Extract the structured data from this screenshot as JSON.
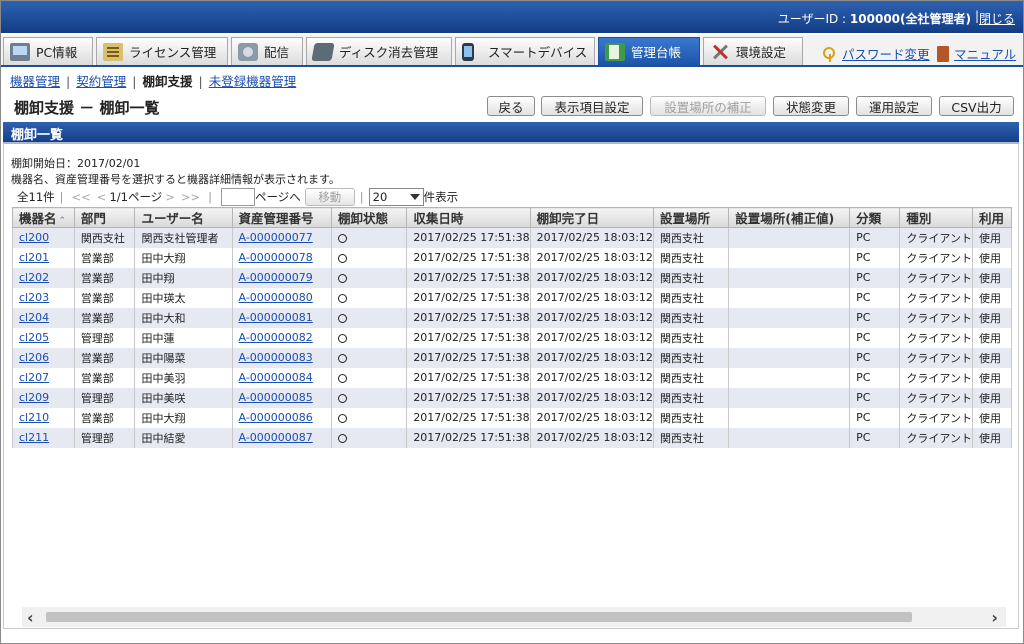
{
  "header": {
    "user_label": "ユーザーID : ",
    "user_value": "100000(全社管理者)",
    "close_label": "閉じる"
  },
  "tabs": [
    {
      "label": "PC情報",
      "icon": "pc-icon"
    },
    {
      "label": "ライセンス管理",
      "icon": "license-icon"
    },
    {
      "label": "配信",
      "icon": "distribution-icon"
    },
    {
      "label": "ディスク消去管理",
      "icon": "disk-erase-icon"
    },
    {
      "label": "スマートデバイス",
      "icon": "smartphone-icon"
    },
    {
      "label": "管理台帳",
      "icon": "ledger-icon"
    },
    {
      "label": "環境設定",
      "icon": "tools-icon"
    }
  ],
  "util_links": {
    "password": "パスワード変更",
    "manual": "マニュアル"
  },
  "subnav": {
    "item1": "機器管理",
    "item2": "契約管理",
    "item3": "棚卸支援",
    "item4": "未登録機器管理"
  },
  "page": {
    "title": "棚卸支援 － 棚卸一覧",
    "section_title": "棚卸一覧",
    "start_date": "棚卸開始日：2017/02/01",
    "hint": "機器名、資産管理番号を選択すると機器詳細情報が表示されます。"
  },
  "buttons": {
    "back": "戻る",
    "display_items": "表示項目設定",
    "correct_location": "設置場所の補正",
    "change_status": "状態変更",
    "operation_settings": "運用設定",
    "csv": "CSV出力"
  },
  "pager": {
    "total": "全11件",
    "first": "<<",
    "prev": "<",
    "page_info": "1/1ページ",
    "next": ">",
    "last": ">>",
    "page_input_value": "",
    "page_suffix": "ページへ",
    "move": "移動",
    "per_page": "20",
    "per_page_suffix": "件表示"
  },
  "table": {
    "columns": [
      "機器名",
      "部門",
      "ユーザー名",
      "資産管理番号",
      "棚卸状態",
      "収集日時",
      "棚卸完了日",
      "設置場所",
      "設置場所(補正値)",
      "分類",
      "種別",
      "利用"
    ],
    "sorted_column_icon": "sort-asc-icon",
    "rows": [
      {
        "device": "cl200",
        "dept": "関西支社",
        "user": "関西支社管理者",
        "asset": "A-000000077",
        "status": "○",
        "collected": "2017/02/25 17:51:38",
        "completed": "2017/02/25 18:03:12",
        "location": "関西支社",
        "location_corrected": "",
        "category": "PC",
        "type": "クライアント",
        "usage": "使用"
      },
      {
        "device": "cl201",
        "dept": "営業部",
        "user": "田中大翔",
        "asset": "A-000000078",
        "status": "○",
        "collected": "2017/02/25 17:51:38",
        "completed": "2017/02/25 18:03:12",
        "location": "関西支社",
        "location_corrected": "",
        "category": "PC",
        "type": "クライアント",
        "usage": "使用"
      },
      {
        "device": "cl202",
        "dept": "営業部",
        "user": "田中翔",
        "asset": "A-000000079",
        "status": "○",
        "collected": "2017/02/25 17:51:38",
        "completed": "2017/02/25 18:03:12",
        "location": "関西支社",
        "location_corrected": "",
        "category": "PC",
        "type": "クライアント",
        "usage": "使用"
      },
      {
        "device": "cl203",
        "dept": "営業部",
        "user": "田中瑛太",
        "asset": "A-000000080",
        "status": "○",
        "collected": "2017/02/25 17:51:38",
        "completed": "2017/02/25 18:03:12",
        "location": "関西支社",
        "location_corrected": "",
        "category": "PC",
        "type": "クライアント",
        "usage": "使用"
      },
      {
        "device": "cl204",
        "dept": "営業部",
        "user": "田中大和",
        "asset": "A-000000081",
        "status": "○",
        "collected": "2017/02/25 17:51:38",
        "completed": "2017/02/25 18:03:12",
        "location": "関西支社",
        "location_corrected": "",
        "category": "PC",
        "type": "クライアント",
        "usage": "使用"
      },
      {
        "device": "cl205",
        "dept": "管理部",
        "user": "田中蓮",
        "asset": "A-000000082",
        "status": "○",
        "collected": "2017/02/25 17:51:38",
        "completed": "2017/02/25 18:03:12",
        "location": "関西支社",
        "location_corrected": "",
        "category": "PC",
        "type": "クライアント",
        "usage": "使用"
      },
      {
        "device": "cl206",
        "dept": "営業部",
        "user": "田中陽菜",
        "asset": "A-000000083",
        "status": "○",
        "collected": "2017/02/25 17:51:38",
        "completed": "2017/02/25 18:03:12",
        "location": "関西支社",
        "location_corrected": "",
        "category": "PC",
        "type": "クライアント",
        "usage": "使用"
      },
      {
        "device": "cl207",
        "dept": "営業部",
        "user": "田中美羽",
        "asset": "A-000000084",
        "status": "○",
        "collected": "2017/02/25 17:51:38",
        "completed": "2017/02/25 18:03:12",
        "location": "関西支社",
        "location_corrected": "",
        "category": "PC",
        "type": "クライアント",
        "usage": "使用"
      },
      {
        "device": "cl209",
        "dept": "管理部",
        "user": "田中美咲",
        "asset": "A-000000085",
        "status": "○",
        "collected": "2017/02/25 17:51:38",
        "completed": "2017/02/25 18:03:12",
        "location": "関西支社",
        "location_corrected": "",
        "category": "PC",
        "type": "クライアント",
        "usage": "使用"
      },
      {
        "device": "cl210",
        "dept": "営業部",
        "user": "田中大翔",
        "asset": "A-000000086",
        "status": "○",
        "collected": "2017/02/25 17:51:38",
        "completed": "2017/02/25 18:03:12",
        "location": "関西支社",
        "location_corrected": "",
        "category": "PC",
        "type": "クライアント",
        "usage": "使用"
      },
      {
        "device": "cl211",
        "dept": "管理部",
        "user": "田中結愛",
        "asset": "A-000000087",
        "status": "○",
        "collected": "2017/02/25 17:51:38",
        "completed": "2017/02/25 18:03:12",
        "location": "関西支社",
        "location_corrected": "",
        "category": "PC",
        "type": "クライアント",
        "usage": "使用"
      }
    ]
  },
  "colors": {
    "header_blue": "#1e4f9c",
    "link_blue": "#1a4fb0",
    "row_stripe": "#e6e9f2"
  }
}
